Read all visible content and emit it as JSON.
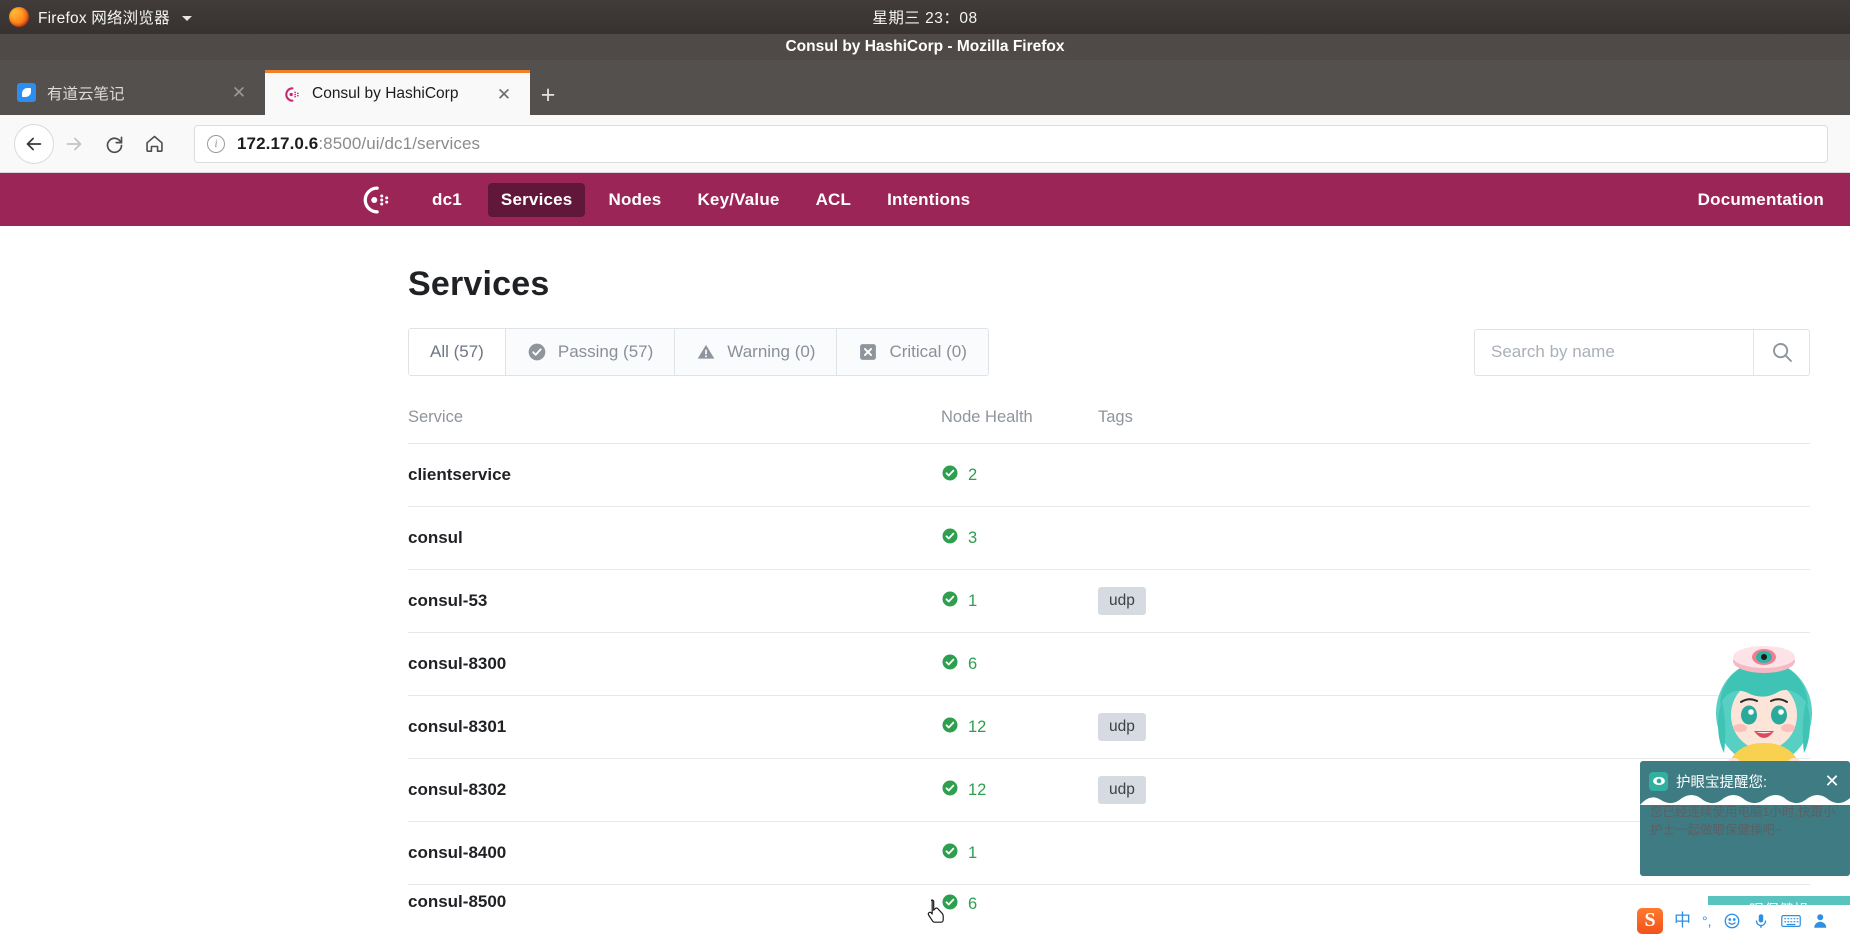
{
  "os_panel": {
    "app_menu_label": "Firefox 网络浏览器",
    "clock": "星期三 23：08",
    "firefox_icon": "firefox-logo-icon",
    "caret_icon": "chevron-down-icon"
  },
  "window": {
    "title": "Consul by HashiCorp - Mozilla Firefox"
  },
  "browser": {
    "tabs": [
      {
        "label": "有道云笔记",
        "favicon": "youdao-note-icon",
        "active": false,
        "close_icon": "close-icon"
      },
      {
        "label": "Consul by HashiCorp",
        "favicon": "consul-logo-icon",
        "active": true,
        "close_icon": "close-icon"
      }
    ],
    "new_tab_label": "+",
    "toolbar": {
      "back_icon": "back-arrow-icon",
      "forward_icon": "forward-arrow-icon",
      "reload_icon": "reload-icon",
      "home_icon": "home-icon",
      "url_info_icon": "info-circle-icon",
      "url_host": "172.17.0.6",
      "url_rest": ":8500/ui/dc1/services"
    }
  },
  "consul_nav": {
    "logo_icon": "consul-logo-icon",
    "datacenter": "dc1",
    "items": [
      {
        "label": "Services",
        "active": true
      },
      {
        "label": "Nodes",
        "active": false
      },
      {
        "label": "Key/Value",
        "active": false
      },
      {
        "label": "ACL",
        "active": false
      },
      {
        "label": "Intentions",
        "active": false
      }
    ],
    "documentation_label": "Documentation",
    "bg_color": "#9c2558",
    "active_bg_color": "#61173a"
  },
  "main": {
    "page_title": "Services",
    "filters": [
      {
        "label": "All (57)",
        "icon": null,
        "active": true
      },
      {
        "label": "Passing (57)",
        "icon": "check-circle-icon",
        "active": false
      },
      {
        "label": "Warning (0)",
        "icon": "warning-triangle-icon",
        "active": false
      },
      {
        "label": "Critical (0)",
        "icon": "x-square-icon",
        "active": false
      }
    ],
    "search": {
      "placeholder": "Search by name",
      "value": "",
      "search_icon": "search-icon"
    },
    "table": {
      "columns": [
        "Service",
        "Node Health",
        "Tags"
      ],
      "rows": [
        {
          "service": "clientservice",
          "health": "2",
          "health_icon": "check-circle-icon",
          "tags": []
        },
        {
          "service": "consul",
          "health": "3",
          "health_icon": "check-circle-icon",
          "tags": []
        },
        {
          "service": "consul-53",
          "health": "1",
          "health_icon": "check-circle-icon",
          "tags": [
            "udp"
          ]
        },
        {
          "service": "consul-8300",
          "health": "6",
          "health_icon": "check-circle-icon",
          "tags": []
        },
        {
          "service": "consul-8301",
          "health": "12",
          "health_icon": "check-circle-icon",
          "tags": [
            "udp"
          ]
        },
        {
          "service": "consul-8302",
          "health": "12",
          "health_icon": "check-circle-icon",
          "tags": [
            "udp"
          ]
        },
        {
          "service": "consul-8400",
          "health": "1",
          "health_icon": "check-circle-icon",
          "tags": []
        },
        {
          "service": "consul-8500",
          "health": "6",
          "health_icon": "check-circle-icon",
          "tags": []
        }
      ],
      "health_ok_color": "#2e9e4f"
    }
  },
  "overlay": {
    "mascot_icon": "nurse-mascot-icon",
    "popup": {
      "app_icon": "eye-care-icon",
      "title": "护眼宝提醒您:",
      "close_icon": "close-icon",
      "message": "您已经连续使用电脑1小时,快跟小护士一起做眼保健操吧~",
      "button_label": "眼保健操",
      "bg_color": "#3e7b82",
      "button_color": "#59c3c0"
    },
    "ime": {
      "logo": "S",
      "items": [
        "中",
        "°,",
        "☺",
        "🎤",
        "⌨",
        "👤"
      ]
    }
  },
  "cursor": {
    "icon": "pointing-hand-cursor"
  }
}
